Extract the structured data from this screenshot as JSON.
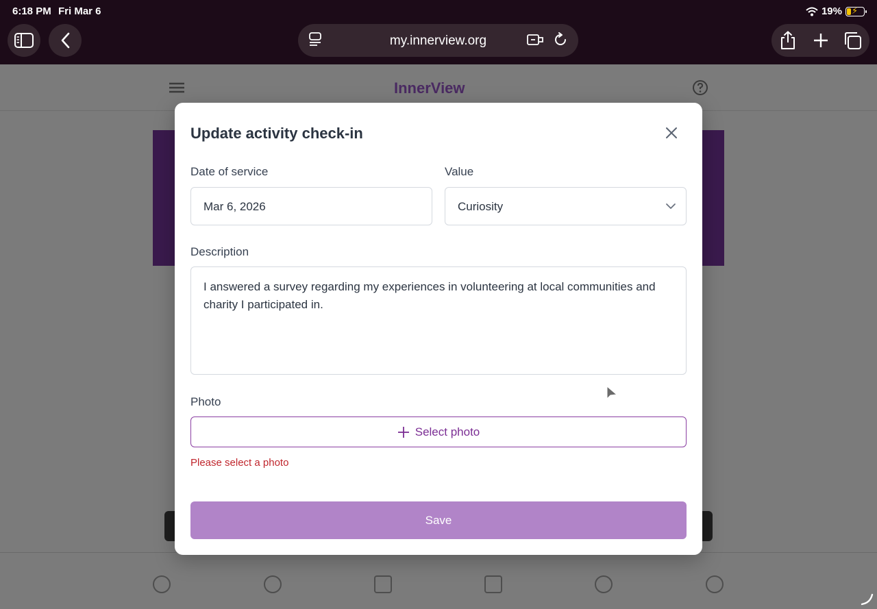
{
  "status_bar": {
    "time": "6:18 PM",
    "date": "Fri Mar 6",
    "battery_percent": "19%"
  },
  "browser": {
    "url": "my.innerview.org"
  },
  "background_page": {
    "brand": "InnerView"
  },
  "modal": {
    "title": "Update activity check-in",
    "date_label": "Date of service",
    "date_value": "Mar 6, 2026",
    "value_label": "Value",
    "value_selected": "Curiosity",
    "description_label": "Description",
    "description_text": "I answered a survey regarding my experiences in volunteering at local communities and charity I participated in.",
    "photo_label": "Photo",
    "select_photo_label": "Select photo",
    "error_text": "Please select a photo",
    "save_label": "Save"
  },
  "colors": {
    "accent": "#7b2e94",
    "save_button": "#b184c8",
    "error": "#c0262d",
    "chrome": "#1c0b18"
  }
}
